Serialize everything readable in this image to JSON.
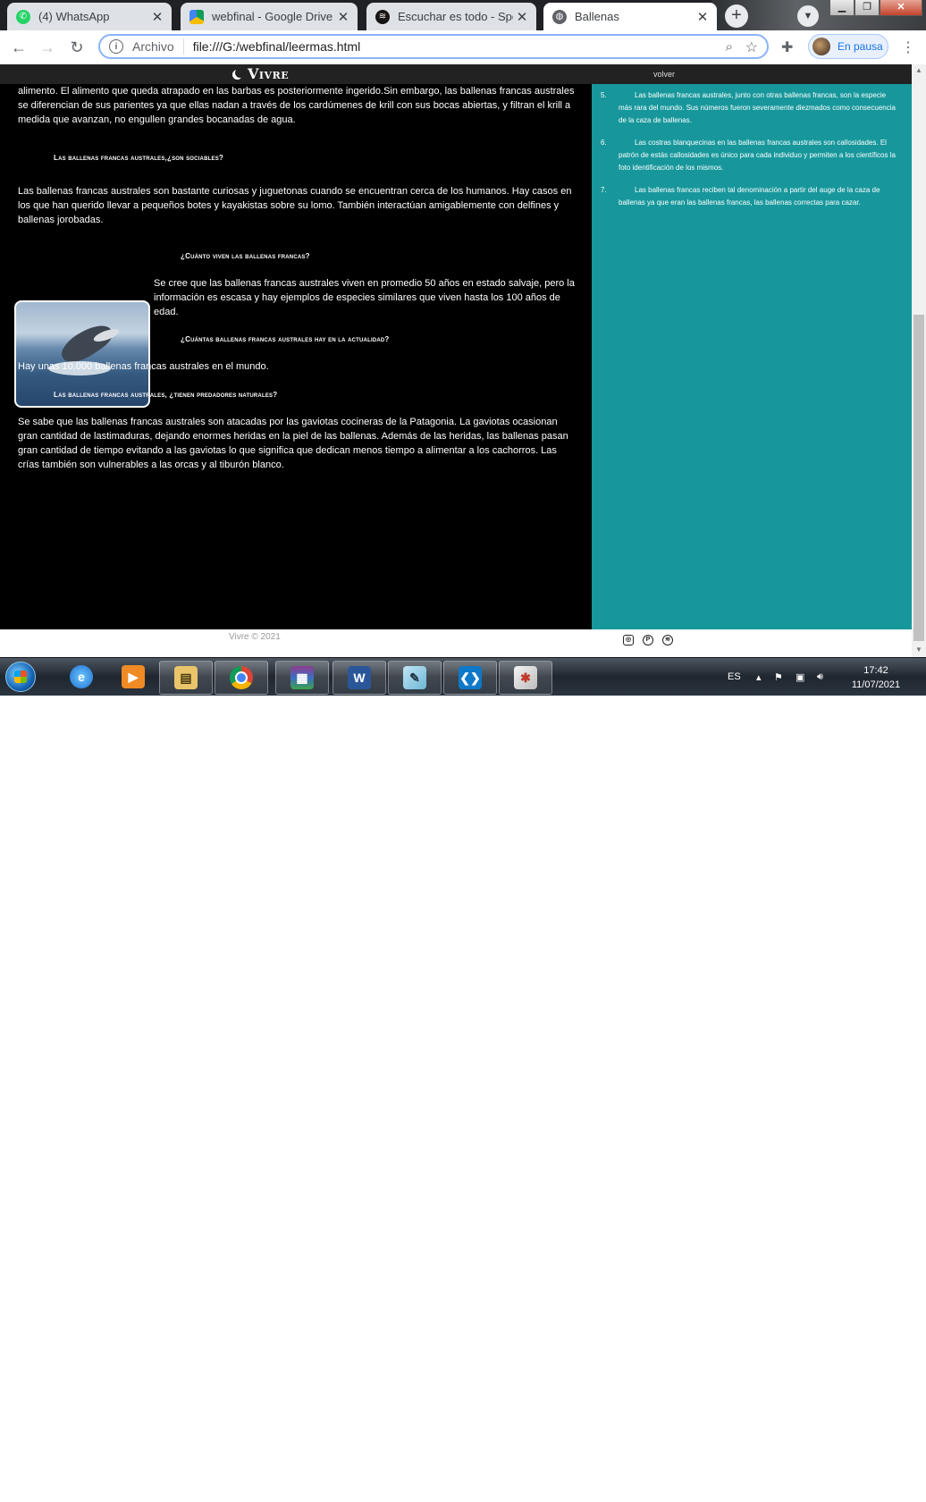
{
  "browser": {
    "tabs": [
      {
        "label": "(4) WhatsApp",
        "icon": "whatsapp-icon",
        "color": "#25d366"
      },
      {
        "label": "webfinal - Google Drive",
        "icon": "google-drive-icon",
        "color": "#fbbc04"
      },
      {
        "label": "Escuchar es todo - Spotify",
        "icon": "spotify-icon",
        "color": "#191414"
      },
      {
        "label": "Ballenas",
        "icon": "globe-icon",
        "color": "#5f6368",
        "active": true
      }
    ],
    "address": {
      "scheme": "Archivo",
      "url": "file:///G:/webfinal/leermas.html"
    },
    "profile_label": "En pausa"
  },
  "page": {
    "brand": "Vivre",
    "nav_link": "volver",
    "intro_paragraph": "alimento. El alimento que queda atrapado en las barbas es posteriormente ingerido.Sin embargo, las ballenas francas australes se diferencian de sus parientes ya que ellas nadan a través de los cardúmenes de krill con sus bocas abiertas, y filtran el krill a medida que avanzan, no engullen grandes bocanadas de agua.",
    "sections": [
      {
        "heading": "Las ballenas francas australes,¿son sociables?",
        "text": "Las ballenas francas australes son bastante curiosas y juguetonas cuando se encuentran cerca de los humanos. Hay casos en los que han querido llevar a pequeños botes y kayakistas sobre su lomo. También interactúan amigablemente con delfines y ballenas jorobadas."
      },
      {
        "heading": "¿Cuánto viven las ballenas francas?",
        "text": "Se cree que las ballenas francas australes viven en promedio 50 años en estado salvaje, pero la información es escasa y hay ejemplos de especies similares que viven hasta los 100 años de edad."
      },
      {
        "heading": "¿Cuántas ballenas francas australes hay en la actualidad?",
        "text": "Hay unas 10.000 ballenas francas australes en el mundo."
      },
      {
        "heading": "Las ballenas francas australes, ¿tienen predadores naturales?",
        "text": "Se sabe que las ballenas francas australes son atacadas por las gaviotas cocineras de la Patagonia. La gaviotas ocasionan gran cantidad de lastimaduras, dejando enormes heridas en la piel de las ballenas. Además de las heridas, las ballenas pasan gran cantidad de tiempo evitando a las gaviotas lo que significa que dedican menos tiempo a alimentar a los cachorros. Las crías también son vulnerables a las orcas y al tiburón blanco."
      }
    ],
    "sidebar_items": [
      {
        "num": "5.",
        "text": "Las ballenas francas australes, junto con otras ballenas francas, son la especie más rara del mundo. Sus números fueron severamente diezmados como consecuencia de la caza de ballenas."
      },
      {
        "num": "6.",
        "text": "Las costras blanquecinas en las ballenas francas australes son callosidades. El patrón de estás callosidades es único para cada individuo y permiten a los científicos la foto identificación de los mismos."
      },
      {
        "num": "7.",
        "text": "Las ballenas francas reciben tal denominación a partir del auge de la caza de ballenas ya que eran las ballenas francas, las ballenas correctas para cazar."
      }
    ],
    "footer_copy": "Vivre © 2021",
    "social": [
      "instagram-icon",
      "pinterest-icon",
      "spotify-icon"
    ],
    "colors": {
      "sidebar": "#17979b",
      "main_bg": "#000000",
      "nav_bg": "#222222"
    }
  },
  "taskbar": {
    "apps": [
      "internet-explorer-icon",
      "media-player-icon",
      "file-explorer-icon",
      "chrome-icon",
      "winrar-icon",
      "word-icon",
      "notepad-icon",
      "vscode-icon",
      "paint-icon"
    ],
    "language": "ES",
    "time": "17:42",
    "date": "11/07/2021"
  }
}
